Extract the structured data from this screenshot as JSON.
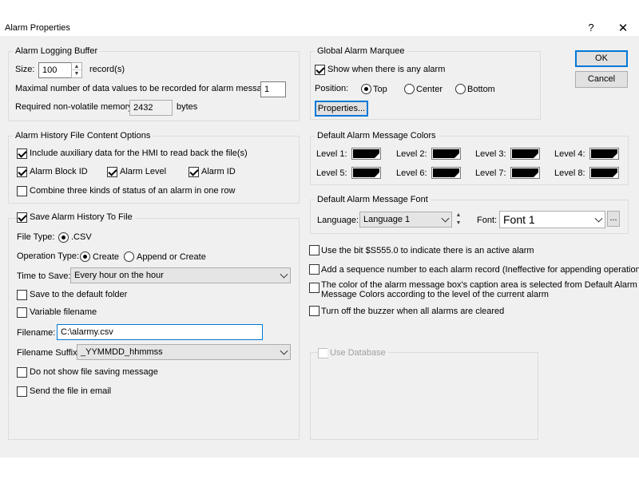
{
  "window": {
    "title": "Alarm Properties",
    "help": "?",
    "close": "✕"
  },
  "buffer": {
    "legend": "Alarm Logging Buffer",
    "size_label": "Size:",
    "size_value": "100",
    "size_unit": "record(s)",
    "max_label": "Maximal number of data values to be recorded for alarm messages:",
    "max_value": "1",
    "mem_label": "Required non-volatile memory:",
    "mem_value": "2432",
    "mem_unit": "bytes"
  },
  "history": {
    "legend": "Alarm History File Content Options",
    "aux": "Include auxiliary data for the HMI to read back the file(s)",
    "block_id": "Alarm Block ID",
    "level": "Alarm Level",
    "alarm_id": "Alarm ID",
    "combine": "Combine three kinds of status of an alarm in one row"
  },
  "save": {
    "legend": "Save Alarm History To File",
    "file_type_label": "File Type:",
    "file_type": ".CSV",
    "op_label": "Operation Type:",
    "op_create": "Create",
    "op_append": "Append or Create",
    "time_label": "Time to Save:",
    "time_value": "Every hour on the hour",
    "default_folder": "Save to the default folder",
    "variable": "Variable filename",
    "filename_label": "Filename:",
    "filename_value": "C:\\alarmy.csv",
    "suffix_label": "Filename Suffix:",
    "suffix_value": "_YYMMDD_hhmmss",
    "no_msg": "Do not show file saving message",
    "email": "Send the file in email"
  },
  "marquee": {
    "legend": "Global Alarm Marquee",
    "show": "Show when there is any alarm",
    "position_label": "Position:",
    "top": "Top",
    "center": "Center",
    "bottom": "Bottom",
    "properties": "Properties..."
  },
  "colors": {
    "legend": "Default Alarm Message Colors",
    "levels": [
      "Level 1:",
      "Level 2:",
      "Level 3:",
      "Level 4:",
      "Level 5:",
      "Level 6:",
      "Level 7:",
      "Level 8:"
    ],
    "swatch_color": "#000000"
  },
  "font": {
    "legend": "Default Alarm Message Font",
    "language_label": "Language:",
    "language_value": "Language 1",
    "font_label": "Font:",
    "font_value": "Font 1",
    "more": "..."
  },
  "options": {
    "bit": "Use the bit $S555.0 to indicate there is an active alarm",
    "seq": "Add a sequence number to each alarm record (Ineffective for appending operations)",
    "caption_1": "The color of the alarm message box's caption area is selected from Default Alarm",
    "caption_2": "Message Colors according to the level of the current alarm",
    "buzzer": "Turn off the buzzer when all alarms are cleared"
  },
  "database": {
    "label": "Use Database"
  },
  "buttons": {
    "ok": "OK",
    "cancel": "Cancel"
  }
}
